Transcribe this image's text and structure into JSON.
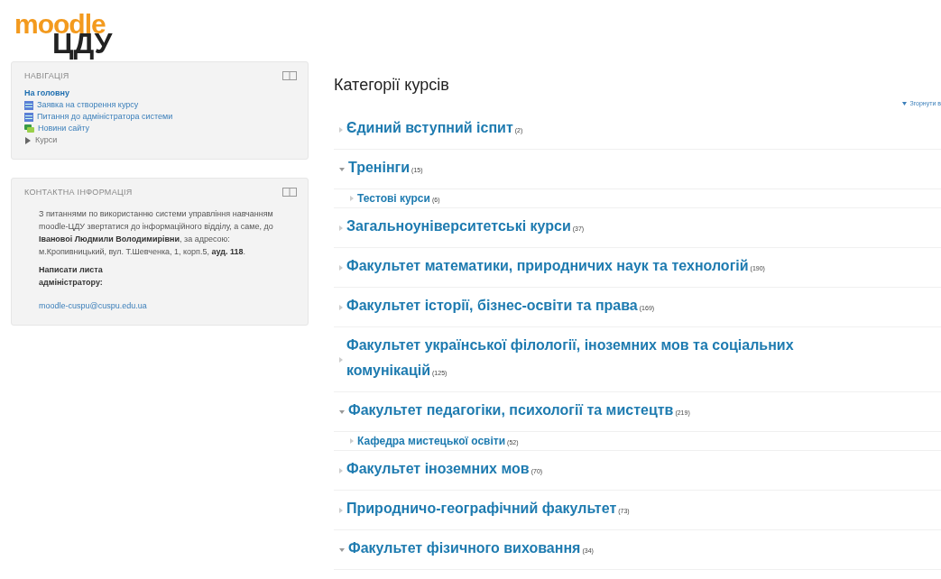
{
  "logo": {
    "top": "moodle",
    "bottom": "ЦДУ"
  },
  "navigation": {
    "title": "НАВІГАЦІЯ",
    "items": [
      {
        "label": "На головну",
        "kind": "home"
      },
      {
        "label": "Заявка на створення курсу",
        "kind": "page"
      },
      {
        "label": "Питання до адміністратора системи",
        "kind": "page"
      },
      {
        "label": "Новини сайту",
        "kind": "forum"
      },
      {
        "label": "Курси",
        "kind": "branch",
        "expanded": false
      }
    ]
  },
  "contact": {
    "title": "КОНТАКТНА ІНФОРМАЦІЯ",
    "text": "З питаннями по використанню системи управління навчанням moodle-ЦДУ звертатися до інформаційного відділу, а саме, до **Івановоі Людмили Володимирівни**, за адресою: м.Кропивницький, вул. Т.Шевченка, 1, корп.5, **ауд. 118**.",
    "write_label": "Написати листа адміністратору:",
    "email": "moodle-cuspu@cuspu.edu.ua"
  },
  "main": {
    "title": "Категорії курсів",
    "collapse_all": "Згорнути в",
    "categories": [
      {
        "name": "Єдиний вступний іспит",
        "count": "(2)",
        "expanded": false
      },
      {
        "name": "Тренінги",
        "count": "(15)",
        "expanded": true,
        "children": [
          {
            "name": "Тестові курси",
            "count": "(6)",
            "expanded": false
          }
        ]
      },
      {
        "name": "Загальноуніверситетські курси",
        "count": "(37)",
        "expanded": false
      },
      {
        "name": "Факультет математики, природничих наук та технологій",
        "count": "(190)",
        "expanded": false
      },
      {
        "name": "Факультет історії, бізнес-освіти та права",
        "count": "(169)",
        "expanded": false
      },
      {
        "name": "Факультет української філології, іноземних мов та соціальних комунікацій",
        "count": "(125)",
        "expanded": false
      },
      {
        "name": "Факультет педагогіки, психології та мистецтв",
        "count": "(219)",
        "expanded": true,
        "children": [
          {
            "name": "Кафедра мистецької освіти",
            "count": "(52)",
            "expanded": false
          }
        ]
      },
      {
        "name": "Факультет іноземних мов",
        "count": "(70)",
        "expanded": false
      },
      {
        "name": "Природничо-географічний факультет",
        "count": "(73)",
        "expanded": false
      },
      {
        "name": "Факультет фізичного виховання",
        "count": "(34)",
        "expanded": true
      }
    ]
  }
}
